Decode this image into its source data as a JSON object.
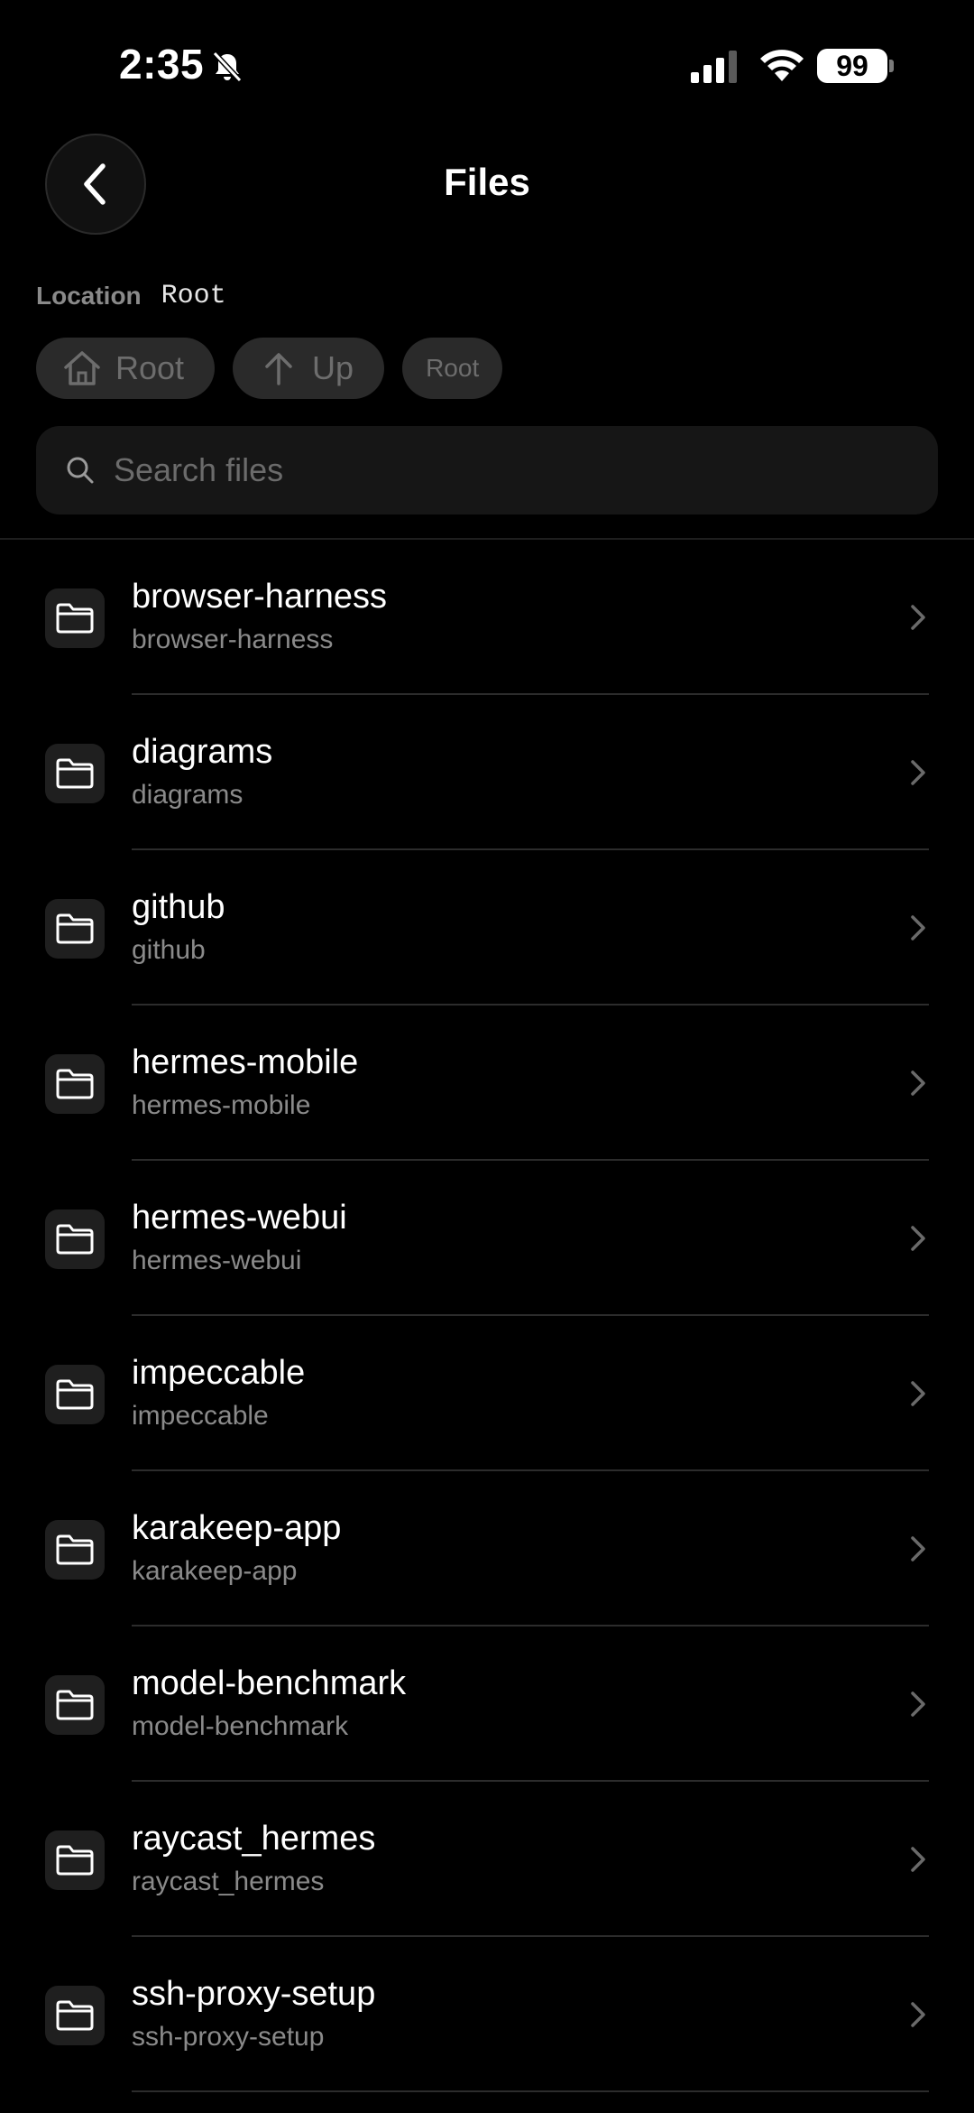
{
  "status_bar": {
    "time": "2:35",
    "battery": "99"
  },
  "header": {
    "title": "Files"
  },
  "location": {
    "label": "Location",
    "value": "Root"
  },
  "chips": {
    "root": "Root",
    "up": "Up",
    "current": "Root"
  },
  "search": {
    "placeholder": "Search files",
    "value": ""
  },
  "files": [
    {
      "name": "browser-harness",
      "path": "browser-harness"
    },
    {
      "name": "diagrams",
      "path": "diagrams"
    },
    {
      "name": "github",
      "path": "github"
    },
    {
      "name": "hermes-mobile",
      "path": "hermes-mobile"
    },
    {
      "name": "hermes-webui",
      "path": "hermes-webui"
    },
    {
      "name": "impeccable",
      "path": "impeccable"
    },
    {
      "name": "karakeep-app",
      "path": "karakeep-app"
    },
    {
      "name": "model-benchmark",
      "path": "model-benchmark"
    },
    {
      "name": "raycast_hermes",
      "path": "raycast_hermes"
    },
    {
      "name": "ssh-proxy-setup",
      "path": "ssh-proxy-setup"
    }
  ]
}
